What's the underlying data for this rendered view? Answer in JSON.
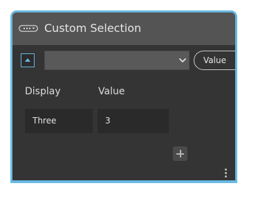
{
  "node": {
    "title": "Custom Selection",
    "accent_color": "#6ab9e3",
    "header_icon": "custom-selection-node-icon",
    "collapse_icon": "collapse-up-icon",
    "dropdown": {
      "value": "",
      "icon": "chevron-down-icon"
    },
    "output_port": {
      "label": "Value"
    },
    "table": {
      "columns": [
        "Display",
        "Value"
      ],
      "rows": [
        {
          "display": "Three",
          "value": "3"
        }
      ]
    },
    "add_icon": "plus-icon",
    "menu_icon": "more-vertical-icon"
  }
}
